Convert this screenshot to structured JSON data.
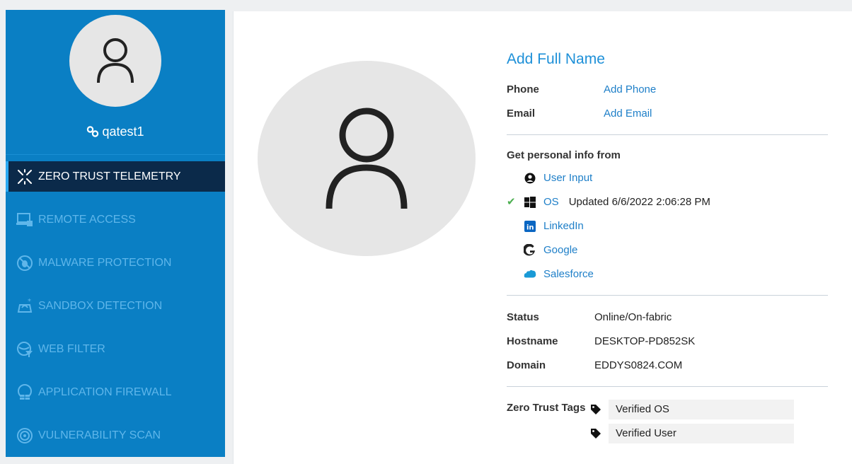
{
  "sidebar": {
    "username": "qatest1",
    "items": [
      {
        "label": "ZERO TRUST TELEMETRY",
        "icon": "telemetry-icon",
        "active": true
      },
      {
        "label": "REMOTE ACCESS",
        "icon": "remote-access-icon",
        "active": false
      },
      {
        "label": "MALWARE PROTECTION",
        "icon": "malware-icon",
        "active": false
      },
      {
        "label": "SANDBOX DETECTION",
        "icon": "sandbox-icon",
        "active": false
      },
      {
        "label": "WEB FILTER",
        "icon": "web-filter-icon",
        "active": false
      },
      {
        "label": "APPLICATION FIREWALL",
        "icon": "app-firewall-icon",
        "active": false
      },
      {
        "label": "VULNERABILITY SCAN",
        "icon": "vuln-scan-icon",
        "active": false
      }
    ]
  },
  "profile": {
    "full_name": "Add Full Name",
    "phone_label": "Phone",
    "phone_value": "Add Phone",
    "email_label": "Email",
    "email_value": "Add Email"
  },
  "sources": {
    "title": "Get personal info from",
    "items": [
      {
        "label": "User Input",
        "icon": "user-input-icon",
        "checked": false,
        "updated": ""
      },
      {
        "label": "OS",
        "icon": "windows-icon",
        "checked": true,
        "updated": "Updated 6/6/2022 2:06:28 PM"
      },
      {
        "label": "LinkedIn",
        "icon": "linkedin-icon",
        "checked": false,
        "updated": ""
      },
      {
        "label": "Google",
        "icon": "google-icon",
        "checked": false,
        "updated": ""
      },
      {
        "label": "Salesforce",
        "icon": "salesforce-icon",
        "checked": false,
        "updated": ""
      }
    ]
  },
  "system": {
    "status_label": "Status",
    "status_value": "Online/On-fabric",
    "hostname_label": "Hostname",
    "hostname_value": "DESKTOP-PD852SK",
    "domain_label": "Domain",
    "domain_value": "EDDYS0824.COM"
  },
  "tags": {
    "label": "Zero Trust Tags",
    "items": [
      "Verified OS",
      "Verified User"
    ]
  },
  "colors": {
    "sidebar_bg": "#0a7fc4",
    "active_bg": "#0b2a4a",
    "link": "#1e90d8",
    "check": "#4caf50"
  }
}
